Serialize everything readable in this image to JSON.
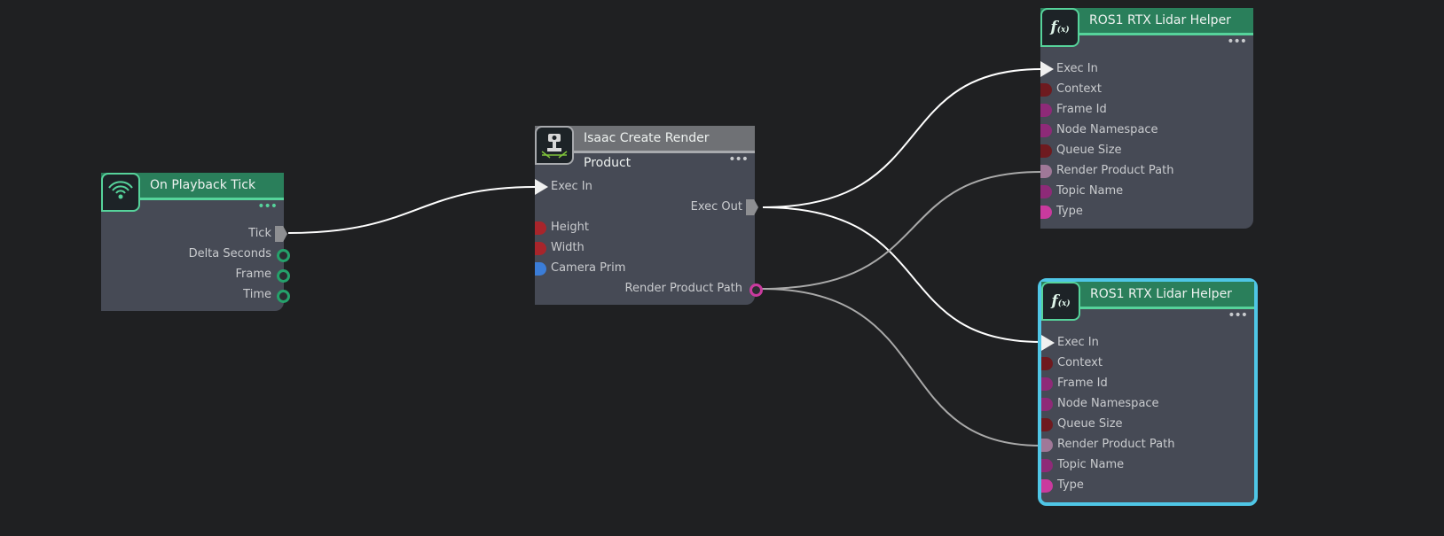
{
  "nodes": {
    "playback_tick": {
      "title": "On Playback Tick",
      "outputs": [
        "Tick",
        "Delta Seconds",
        "Frame",
        "Time"
      ]
    },
    "render_product": {
      "title": "Isaac Create Render Product",
      "exec_in": "Exec In",
      "exec_out": "Exec Out",
      "inputs": [
        "Height",
        "Width",
        "Camera Prim"
      ],
      "output": "Render Product Path"
    },
    "lidar_helper_1": {
      "title": "ROS1 RTX Lidar Helper",
      "inputs": [
        "Exec In",
        "Context",
        "Frame Id",
        "Node Namespace",
        "Queue Size",
        "Render Product Path",
        "Topic Name",
        "Type"
      ]
    },
    "lidar_helper_2": {
      "title": "ROS1 RTX Lidar Helper",
      "inputs": [
        "Exec In",
        "Context",
        "Frame Id",
        "Node Namespace",
        "Queue Size",
        "Render Product Path",
        "Topic Name",
        "Type"
      ]
    }
  },
  "colors": {
    "background": "#1f2022",
    "node_body": "#464a55",
    "header_green": "#2a7f5b",
    "header_grey": "#6f7175",
    "selection": "#4fc6e6",
    "exec_wire": "#ffffff",
    "data_wire": "#a9a9a9"
  },
  "icons": {
    "playback_tick": "broadcast-icon",
    "render_product": "camera-render-icon",
    "lidar_helper": "function-icon"
  }
}
